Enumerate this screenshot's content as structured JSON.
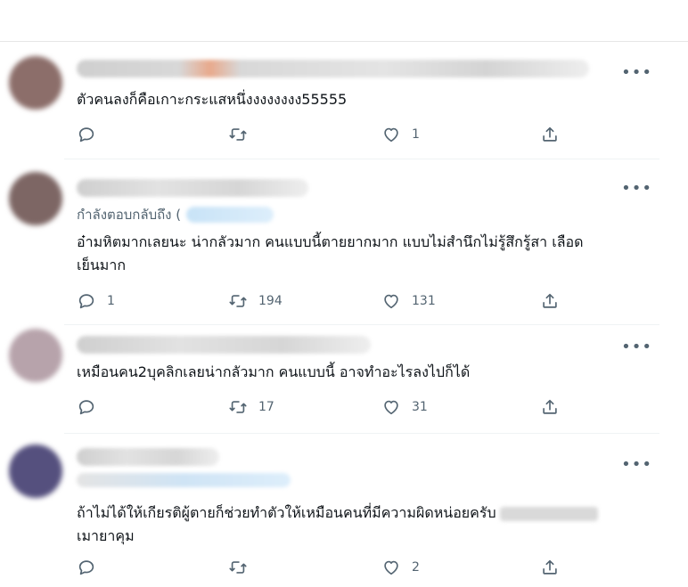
{
  "tweets": [
    {
      "text": "ตัวคนลงก็คือเกาะกระแสหนึ่งงงงงงงง55555",
      "replying_to": "",
      "replies": "",
      "retweets": "",
      "likes": "1",
      "avatar_color": "#8c6e6a"
    },
    {
      "text_line1": "อ๋ามหิตมากเลยนะ น่ากลัวมาก คนแบบนี้ตายยากมาก แบบไม่สำนึกไม่รู้สึกรู้สา เลือด",
      "text_line2": "เย็นมาก",
      "replying_to": "กำลังตอบกลับถึง (",
      "replies": "1",
      "retweets": "194",
      "likes": "131",
      "avatar_color": "#7d6664"
    },
    {
      "text": "เหมือนคน2บุคลิกเลยน่ากลัวมาก คนแบบนี้ อาจทำอะไรลงไปก็ได้",
      "replies": "",
      "retweets": "17",
      "likes": "31",
      "avatar_color": "#b7a3ab"
    },
    {
      "text_line1": "ถ้าไม่ได้ให้เกียรติผู้ตายก็ช่วยทำตัวให้เหมือนคนที่มีความผิดหน่อยครับ",
      "text_line2": "เมายาคุม",
      "replies": "",
      "retweets": "",
      "likes": "2",
      "avatar_color": "#55507e"
    }
  ],
  "more_label": "•••",
  "icons": {
    "reply": "reply-icon",
    "retweet": "retweet-icon",
    "like": "heart-icon",
    "share": "share-icon",
    "more": "more-icon"
  }
}
